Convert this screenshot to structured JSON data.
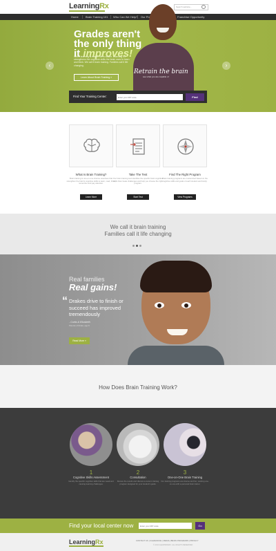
{
  "header": {
    "logo_text": "Learning",
    "logo_accent": "Rx",
    "search_placeholder": "Search website..."
  },
  "nav": {
    "items": [
      {
        "label": "Home"
      },
      {
        "label": "Brain Training 101"
      },
      {
        "label": "Who Can We Help?"
      },
      {
        "label": "Our Programs"
      },
      {
        "label": "About Us"
      },
      {
        "label": "Franchise Opportunity"
      }
    ]
  },
  "hero": {
    "title_line1": "Grades aren't",
    "title_line2": "the only thing",
    "title_line3_plain": "it ",
    "title_line3_em": "improves!",
    "body": "When learning is easier, life is easier. Learning Rx strengthens the cognitive skills the brain uses to learn and think. We call it brain training. Families call it life changing.",
    "button_label": "Learn About Brain Training »",
    "script_text": "Retrain the brain",
    "script_sub": "see what you are capable of",
    "prev_arrow": "‹",
    "next_arrow": "›",
    "finder_label": "Find Your Training Center:",
    "finder_placeholder": "Enter your ZIP code",
    "finder_button": "Find"
  },
  "features": [
    {
      "icon": "brain-icon",
      "title": "What Is Brain Training?",
      "desc": "Brain training is one-on-one intense exercises that strengthen the brain's cognitive skills to learn, read, think, remember and pay attention.",
      "button": "Learn More"
    },
    {
      "icon": "test-document-icon",
      "title": "Take The Test",
      "desc": "Our brain training test identifies the specific brain cognitive skills that create challenges and help you choose the right program.",
      "button": "Start Test"
    },
    {
      "icon": "compass-icon",
      "title": "Find The Right Program",
      "desc": "Brain training programs are customized based on the cognitive skills and goals of each student and family.",
      "button": "View Programs"
    }
  ],
  "quote_band": {
    "line1": "We call it brain training",
    "line2": "Families call it life changing"
  },
  "testimonial": {
    "sub": "Real families",
    "head": "Real gains!",
    "quote_mark": "“",
    "quote": "Drakes drive to finish or succeed has improved tremendously",
    "author": "- Curtis & Elizabeth",
    "meta": "Parents of Drake, age 8",
    "button": "Read More »"
  },
  "how": {
    "title": "How Does Brain Training Work?"
  },
  "steps": [
    {
      "num": "1",
      "title": "Cognitive Skills Assessment",
      "desc": "Identify the specific cognitive skills that are weak and causing learning challenges."
    },
    {
      "num": "2",
      "title": "Consultation",
      "desc": "Review the results and discuss a custom training program designed for your student's goals."
    },
    {
      "num": "3",
      "title": "One-on-One Brain Training",
      "desc": "Our training programs are intense and fun, working one-on-one with a personal brain trainer."
    }
  ],
  "findbar": {
    "title": "Find your local center now",
    "placeholder": "Enter your ZIP code",
    "button": "Go"
  },
  "footer": {
    "logo_text": "Learning",
    "logo_accent": "Rx",
    "links": "CONTACT US  |  CLEARANCE  |  MEDIA  |  BRAIN PROGRAMS  |  PRIVACY",
    "copyright": "© 2014 LEARNINGRX. ALL RIGHTS RESERVED"
  },
  "colors": {
    "brand_green": "#9db143",
    "brand_purple": "#55317a",
    "nav_dark": "#2d2d2d"
  }
}
